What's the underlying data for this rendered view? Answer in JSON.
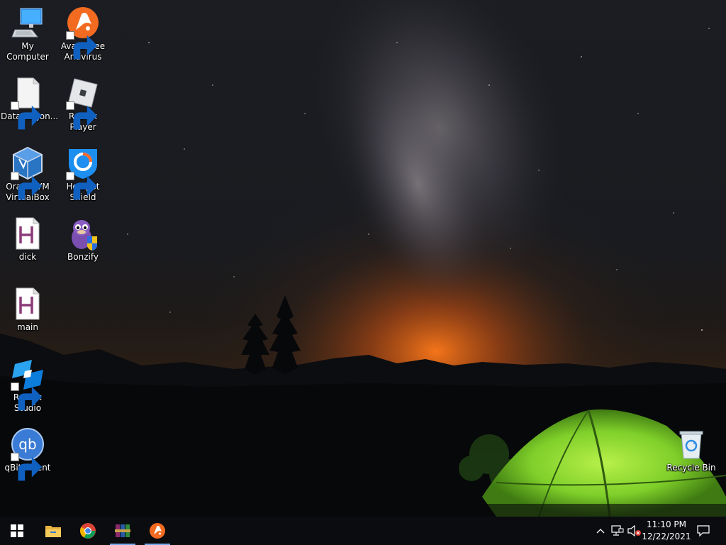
{
  "desktop": {
    "icons": [
      {
        "label": "My Computer"
      },
      {
        "label": "Avast Free\nAntivirus"
      },
      {
        "label": "DataWagon..."
      },
      {
        "label": "Roblox Player"
      },
      {
        "label": "Oracle VM\nVirtualBox"
      },
      {
        "label": "Hotspot\nShield"
      },
      {
        "label": "dick"
      },
      {
        "label": "Bonzify"
      },
      {
        "label": "main"
      },
      {
        "label": "Roblox Studio"
      },
      {
        "label": "qBittorrent"
      },
      {
        "label": "Recycle Bin"
      }
    ]
  },
  "taskbar": {
    "pinned": [
      "start-icon",
      "file-explorer-icon",
      "chrome-icon",
      "winrar-icon",
      "avast-icon"
    ],
    "clock": {
      "time": "11:10 PM",
      "date": "12/22/2021"
    }
  },
  "colors": {
    "taskbar_bg": "#0b0c10",
    "active_indicator": "#76a7e6",
    "avast_orange": "#f26b21",
    "tent_green": "#8fd63a"
  }
}
